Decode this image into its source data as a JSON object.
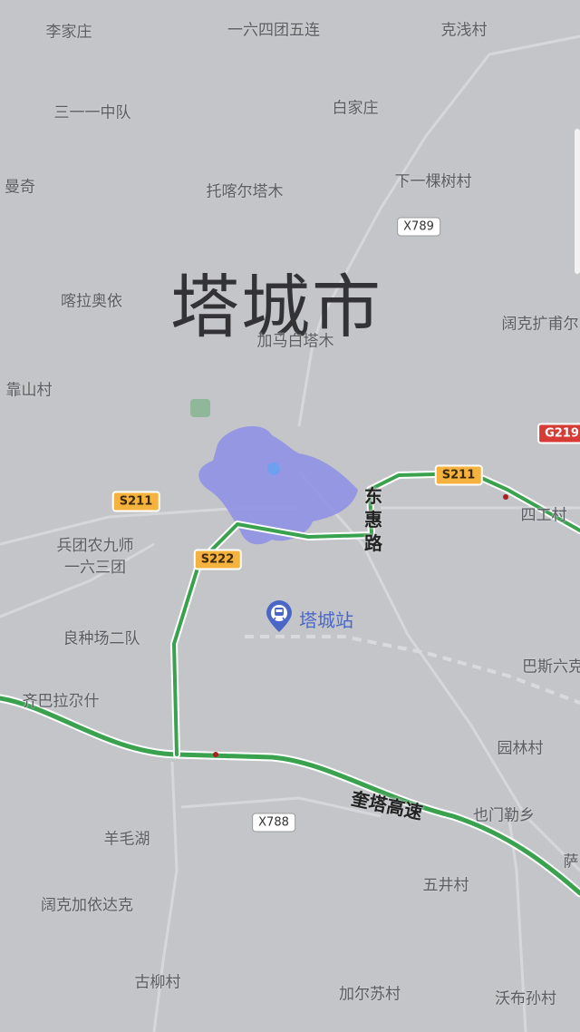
{
  "map": {
    "city_label": "塔城市",
    "places": [
      {
        "id": "lijiazhuang",
        "text": "李家庄"
      },
      {
        "id": "yiliusituan",
        "text": "一六四团五连"
      },
      {
        "id": "keqiancun",
        "text": "克浅村"
      },
      {
        "id": "sanyiyi",
        "text": "三一一中队"
      },
      {
        "id": "baijiazhuang",
        "text": "白家庄"
      },
      {
        "id": "manqi",
        "text": "曼奇"
      },
      {
        "id": "tuokaer",
        "text": "托喀尔塔木"
      },
      {
        "id": "xiayikeshu",
        "text": "下一棵树村"
      },
      {
        "id": "kalaaoyi",
        "text": "喀拉奥依"
      },
      {
        "id": "jiamabai",
        "text": "加马白塔木"
      },
      {
        "id": "kuokekuang",
        "text": "阔克扩甫尔"
      },
      {
        "id": "kaoshan",
        "text": "靠山村"
      },
      {
        "id": "sigongcun",
        "text": "四工村"
      },
      {
        "id": "bingtuan",
        "text": "兵团农九师\n一六三团"
      },
      {
        "id": "liangzhong",
        "text": "良种场二队"
      },
      {
        "id": "basi",
        "text": "巴斯六克"
      },
      {
        "id": "qibala",
        "text": "齐巴拉尕什"
      },
      {
        "id": "yuanlin",
        "text": "园林村"
      },
      {
        "id": "yemen",
        "text": "也门勒乡"
      },
      {
        "id": "yangmao",
        "text": "羊毛湖"
      },
      {
        "id": "sa",
        "text": "萨"
      },
      {
        "id": "wujing",
        "text": "五井村"
      },
      {
        "id": "kuokejia",
        "text": "阔克加依达克"
      },
      {
        "id": "guliu",
        "text": "古柳村"
      },
      {
        "id": "jiaersu",
        "text": "加尔苏村"
      },
      {
        "id": "wobusun",
        "text": "沃布孙村"
      }
    ],
    "shields": [
      {
        "id": "x789",
        "text": "X789",
        "kind": "county"
      },
      {
        "id": "g219",
        "text": "G219",
        "kind": "nat"
      },
      {
        "id": "s211-east",
        "text": "S211",
        "kind": "prov"
      },
      {
        "id": "s211-west",
        "text": "S211",
        "kind": "prov"
      },
      {
        "id": "s222",
        "text": "S222",
        "kind": "prov"
      },
      {
        "id": "x788",
        "text": "X788",
        "kind": "county"
      }
    ],
    "roads": {
      "donghui": "东\n惠\n路",
      "kuita": "奎塔高速"
    },
    "station": {
      "label": "塔城站",
      "icon": "train-station-icon"
    },
    "colors": {
      "background": "#c4c5c8",
      "highway": "#3aa14e",
      "provincial_shield": "#f6b23e",
      "national_shield": "#d63b35",
      "urban_blob": "#8d8ee8",
      "station": "#4a67c8",
      "park": "#8fb89a"
    }
  }
}
